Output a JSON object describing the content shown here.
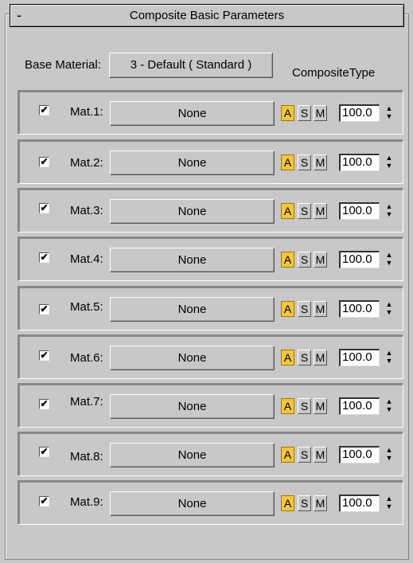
{
  "header": {
    "collapse_symbol": "-",
    "title": "Composite Basic Parameters"
  },
  "base_material": {
    "label": "Base Material:",
    "button": "3 - Default  ( Standard )"
  },
  "composite_type_label": "CompositeType",
  "icons": {
    "check": "checkmark-icon",
    "spinner_up": "spinner-up-icon",
    "spinner_down": "spinner-down-icon"
  },
  "colors": {
    "active_mode": "#f5c542",
    "panel": "#c8c8c8"
  },
  "rows": [
    {
      "checked": true,
      "label": "Mat.1:",
      "material": "None",
      "mode_a": "A",
      "mode_s": "S",
      "mode_m": "M",
      "active_mode": "A",
      "amount": "100.0"
    },
    {
      "checked": true,
      "label": "Mat.2:",
      "material": "None",
      "mode_a": "A",
      "mode_s": "S",
      "mode_m": "M",
      "active_mode": "A",
      "amount": "100.0"
    },
    {
      "checked": true,
      "label": "Mat.3:",
      "material": "None",
      "mode_a": "A",
      "mode_s": "S",
      "mode_m": "M",
      "active_mode": "A",
      "amount": "100.0"
    },
    {
      "checked": true,
      "label": "Mat.4:",
      "material": "None",
      "mode_a": "A",
      "mode_s": "S",
      "mode_m": "M",
      "active_mode": "A",
      "amount": "100.0"
    },
    {
      "checked": true,
      "label": "Mat.5:",
      "material": "None",
      "mode_a": "A",
      "mode_s": "S",
      "mode_m": "M",
      "active_mode": "A",
      "amount": "100.0"
    },
    {
      "checked": true,
      "label": "Mat.6:",
      "material": "None",
      "mode_a": "A",
      "mode_s": "S",
      "mode_m": "M",
      "active_mode": "A",
      "amount": "100.0"
    },
    {
      "checked": true,
      "label": "Mat.7:",
      "material": "None",
      "mode_a": "A",
      "mode_s": "S",
      "mode_m": "M",
      "active_mode": "A",
      "amount": "100.0"
    },
    {
      "checked": true,
      "label": "Mat.8:",
      "material": "None",
      "mode_a": "A",
      "mode_s": "S",
      "mode_m": "M",
      "active_mode": "A",
      "amount": "100.0"
    },
    {
      "checked": true,
      "label": "Mat.9:",
      "material": "None",
      "mode_a": "A",
      "mode_s": "S",
      "mode_m": "M",
      "active_mode": "A",
      "amount": "100.0"
    }
  ]
}
